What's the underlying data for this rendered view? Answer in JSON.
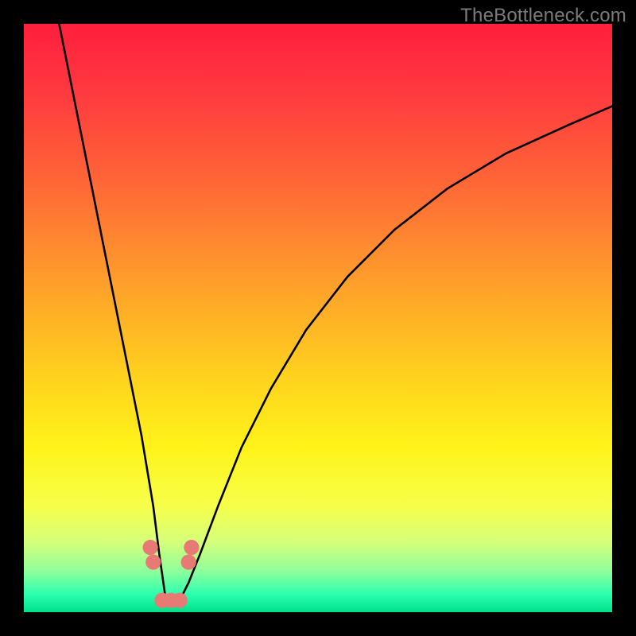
{
  "watermark": "TheBottleneck.com",
  "chart_data": {
    "type": "line",
    "title": "",
    "xlabel": "",
    "ylabel": "",
    "xlim": [
      0,
      100
    ],
    "ylim": [
      0,
      100
    ],
    "series": [
      {
        "name": "bottleneck-curve",
        "x": [
          6,
          8,
          10,
          12,
          14,
          16,
          18,
          20,
          22,
          23,
          24,
          25,
          26,
          27,
          28,
          30,
          33,
          37,
          42,
          48,
          55,
          63,
          72,
          82,
          93,
          100
        ],
        "values": [
          100,
          90,
          80,
          70,
          60,
          50,
          40,
          30,
          18,
          10,
          3,
          2,
          2,
          3,
          5,
          10,
          18,
          28,
          38,
          48,
          57,
          65,
          72,
          78,
          83,
          86
        ]
      }
    ],
    "gradient_stops": [
      {
        "offset": 0.0,
        "color": "#ff1f3e"
      },
      {
        "offset": 0.12,
        "color": "#ff3a3f"
      },
      {
        "offset": 0.28,
        "color": "#ff6a36"
      },
      {
        "offset": 0.45,
        "color": "#ffa22a"
      },
      {
        "offset": 0.6,
        "color": "#ffd21e"
      },
      {
        "offset": 0.72,
        "color": "#fff31a"
      },
      {
        "offset": 0.82,
        "color": "#f6ff4a"
      },
      {
        "offset": 0.88,
        "color": "#d6ff7a"
      },
      {
        "offset": 0.93,
        "color": "#8fff9a"
      },
      {
        "offset": 0.97,
        "color": "#2bffb0"
      },
      {
        "offset": 1.0,
        "color": "#00e08a"
      }
    ],
    "markers": [
      {
        "name": "left-upper",
        "x": 21.5,
        "y": 11.0,
        "color": "#e77a74"
      },
      {
        "name": "left-lower",
        "x": 22.0,
        "y": 8.5,
        "color": "#e77a74"
      },
      {
        "name": "right-upper",
        "x": 28.5,
        "y": 11.0,
        "color": "#e77a74"
      },
      {
        "name": "right-lower",
        "x": 28.0,
        "y": 8.5,
        "color": "#e77a74"
      },
      {
        "name": "flat-left",
        "x": 23.5,
        "y": 2.0,
        "color": "#e77a74"
      },
      {
        "name": "flat-mid",
        "x": 25.0,
        "y": 2.0,
        "color": "#e77a74"
      },
      {
        "name": "flat-right",
        "x": 26.5,
        "y": 2.0,
        "color": "#e77a74"
      }
    ]
  }
}
